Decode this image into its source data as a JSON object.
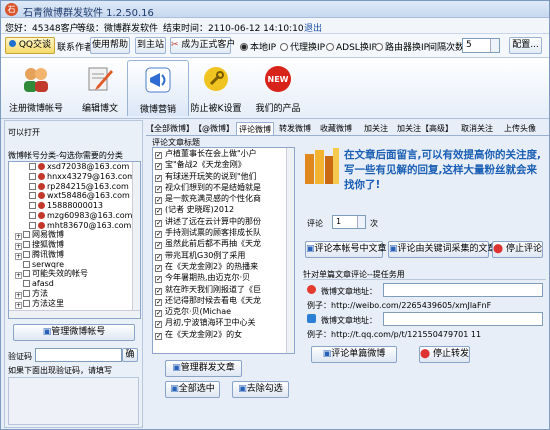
{
  "app": {
    "title": "石青微博群发软件 1.2.50.16"
  },
  "info": {
    "customer": "您好：45348客户",
    "level": "等级：微博群发软件",
    "expire": "结束时间：2110-06-12 14:10:10",
    "exit": "退出"
  },
  "toolbar": {
    "qq_label": "QQ交谈",
    "contact": "联系作者",
    "help": "使用帮助",
    "home": "到主站",
    "upgrade": "成为正式客户",
    "radios": [
      "本地IP",
      "代理换IP",
      "ADSL换IP",
      "路由器换IP"
    ],
    "interval_label": "间隔次数",
    "interval_value": "5",
    "settings": "配置..."
  },
  "nav": [
    {
      "label": "注册微博帐号",
      "icon": "users-icon"
    },
    {
      "label": "编辑博文",
      "icon": "edit-icon"
    },
    {
      "label": "微博营销",
      "icon": "megaphone-icon"
    },
    {
      "label": "防止被K设置",
      "icon": "wrench-icon"
    },
    {
      "label": "我们的产品",
      "icon": "new-badge-icon"
    }
  ],
  "left": {
    "status": "可以打开",
    "heading": "微博帐号分类-勾选你需要的分类",
    "tree": [
      {
        "type": "acct",
        "text": "xsd72038@163.com"
      },
      {
        "type": "acct",
        "text": "hnxx43279@163.com"
      },
      {
        "type": "acct",
        "text": "rp284215@163.com"
      },
      {
        "type": "acct",
        "text": "wxt58486@163.com"
      },
      {
        "type": "acct",
        "text": "15888000013"
      },
      {
        "type": "acct",
        "text": "mzg60983@163.com"
      },
      {
        "type": "acct",
        "text": "mht83670@163.com"
      },
      {
        "type": "group",
        "text": "网易微博"
      },
      {
        "type": "group",
        "text": "搜狐微博"
      },
      {
        "type": "group",
        "text": "腾讯微博"
      },
      {
        "type": "plain",
        "text": "serwqre"
      },
      {
        "type": "group",
        "text": "可能失效的帐号"
      },
      {
        "type": "plain",
        "text": "afasd"
      },
      {
        "type": "group",
        "text": "方法"
      },
      {
        "type": "group",
        "text": "方法这里"
      }
    ],
    "manage_btn": "管理微博帐号",
    "captcha_label": "验证码",
    "confirm_btn": "确",
    "captcha_hint": "如果下面出现验证码，请填写"
  },
  "tabs": [
    "【全部微博】",
    "【@微博】",
    "评论微博",
    "转发微博",
    "收藏微博",
    "加关注",
    "加关注【高级】",
    "取消关注",
    "上传头像"
  ],
  "mid": {
    "heading": "评论文章标题",
    "items": [
      "卢植董事长在会上做\"小户",
      "宝\"备战2《天龙金刚》",
      "有球迷开玩笑的说到\"他们",
      "视众们想到的不是结婚就是",
      "是一款充满灵感的个性化商",
      "(记者 史晓晖)2012",
      "讲述了远在云计算中的那份",
      "手持测试票的顾客排成长队",
      "虽然此前后都不再抽《天龙",
      "带兆耳机G30例了采用",
      "在《天龙金刚2》的热播来",
      "今年暑期热,由迈克尔·贝",
      "就在昨天我们刚报道了《巨",
      "还记得那时候去看电《天龙",
      "迈克尔·贝(Michae",
      "月初,宁波镇海环卫中心关",
      "在《天龙金刚2》的女"
    ],
    "manage_btn": "管理群发文章",
    "select_all": "全部选中",
    "deselect": "去除勾选"
  },
  "right": {
    "promo": "在文章后面留言,可以有效提高你的关注度,写一些有见解的回复,这样大量粉丝就会来找你了!",
    "comment_label": "评论",
    "comment_value": "1",
    "comment_unit": "次",
    "btn_account": "评论本帐号中文章",
    "btn_keyword": "评论由关键词采集的文章",
    "btn_stop": "停止评论",
    "single_heading": "针对单篇文章评论--提任务用",
    "sina_label": "微博文章地址：",
    "sina_example": "例子：http://weibo.com/2265439605/xmJlaFnF",
    "qq_label": "微博文章地址：",
    "qq_example": "例子：http://t.qq.com/p/t/121550479701 11",
    "btn_single": "评论单篇微博",
    "btn_stop_forward": "停止转发"
  },
  "colors": {
    "promo": "#1a5fb4",
    "accent": "#7d9ac2"
  }
}
